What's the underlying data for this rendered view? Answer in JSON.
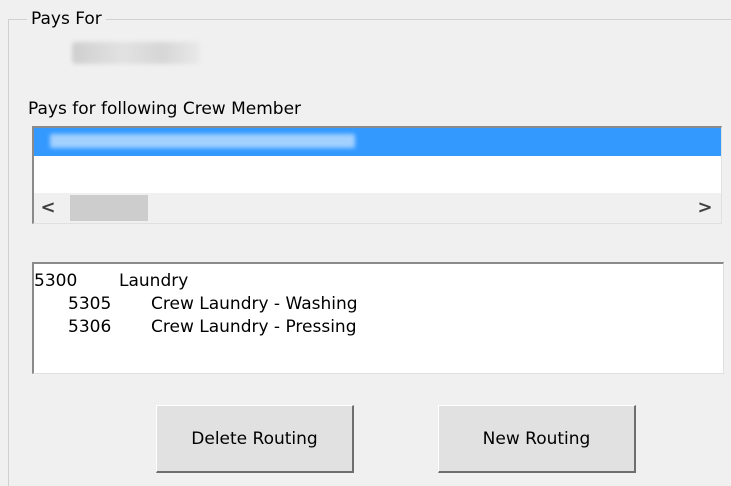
{
  "group": {
    "title": "Pays For"
  },
  "crew_section": {
    "label": "Pays for following Crew Member"
  },
  "routing_list": {
    "rows": [
      {
        "code": "5300",
        "description": "Laundry"
      },
      {
        "code": "5305",
        "description": "Crew Laundry - Washing"
      },
      {
        "code": "5306",
        "description": "Crew Laundry - Pressing"
      }
    ]
  },
  "scrollbar": {
    "left_arrow": "<",
    "right_arrow": ">"
  },
  "buttons": {
    "delete_label": "Delete Routing",
    "new_label": "New Routing"
  },
  "colors": {
    "selection": "#3399ff",
    "background": "#f0f0f0"
  }
}
